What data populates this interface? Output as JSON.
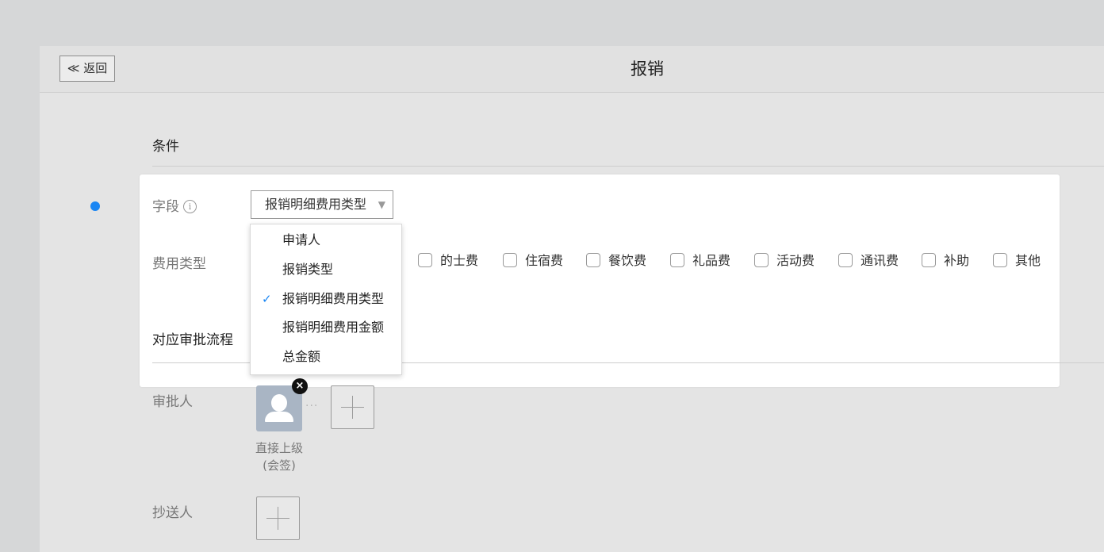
{
  "header": {
    "back_label": "≪ 返回",
    "title": "报销"
  },
  "conditions": {
    "section_title": "条件",
    "field_label": "字段",
    "field_info_icon": "i",
    "field_select_value": "报销明细费用类型",
    "expense_type_label": "费用类型",
    "expense_types": [
      "的士费",
      "住宿费",
      "餐饮费",
      "礼品费",
      "活动费",
      "通讯费",
      "补助",
      "其他"
    ],
    "flow_title": "对应审批流程"
  },
  "dropdown": {
    "options": [
      "申请人",
      "报销类型",
      "报销明细费用类型",
      "报销明细费用金额",
      "总金额"
    ],
    "selected": "报销明细费用类型",
    "check_mark": "✓"
  },
  "approval": {
    "approver_label": "审批人",
    "approver_name": "直接上级",
    "approver_mode": "(会签)",
    "remove_glyph": "×",
    "cc_label": "抄送人"
  },
  "colors": {
    "accent": "#1a86f3",
    "avatar": "#a9b5c4"
  }
}
